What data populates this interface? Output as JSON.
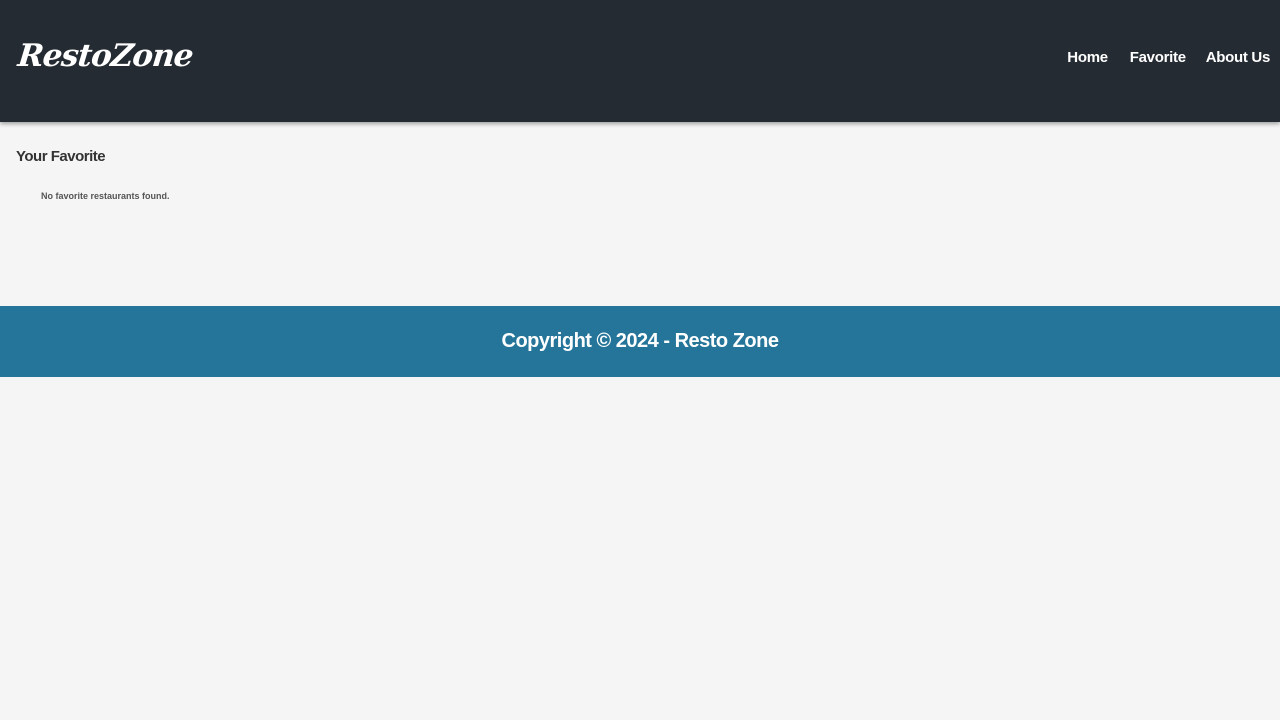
{
  "header": {
    "brand": "RestoZone",
    "nav": [
      {
        "label": "Home"
      },
      {
        "label": "Favorite"
      },
      {
        "label": "About Us"
      }
    ]
  },
  "main": {
    "title": "Your Favorite",
    "empty_message": "No favorite restaurants found."
  },
  "footer": {
    "copyright": "Copyright © 2024 - Resto Zone"
  },
  "colors": {
    "header_bg": "#252b33",
    "page_bg": "#f5f5f5",
    "footer_bg": "#247599",
    "text_on_dark": "#ffffff",
    "heading_text": "#333333"
  }
}
